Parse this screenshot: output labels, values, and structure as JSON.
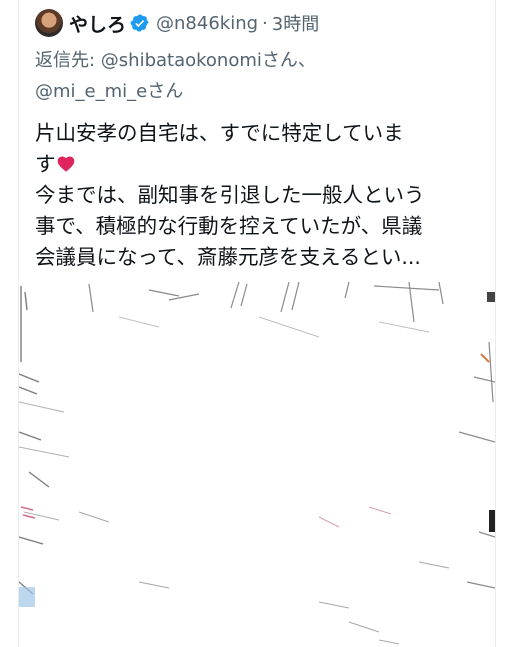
{
  "tweet": {
    "display_name": "やしろ",
    "handle": "@n846king",
    "separator": "·",
    "time": "3時間",
    "reply_prefix": "返信先: ",
    "reply_to_1": "@shibataokonomiさん、",
    "reply_to_2": "@mi_e_mi_eさん",
    "body_line_1": "片山安孝の自宅は、すでに特定していま",
    "body_line_2_text": "す",
    "body_line_3": "今までは、副知事を引退した一般人という",
    "body_line_4": "事で、積極的な行動を控えていたが、県議",
    "body_line_5": "会議員になって、斎藤元彦を支えるとい..."
  },
  "icons": {
    "avatar": "avatar-image",
    "verified": "verified-badge-icon",
    "heart": "red-heart-emoji-icon",
    "media": "redacted-map-image"
  },
  "colors": {
    "text": "#0f1419",
    "secondary": "#536471",
    "verified_blue": "#1d9bf0",
    "heart_red": "#e0245e"
  }
}
